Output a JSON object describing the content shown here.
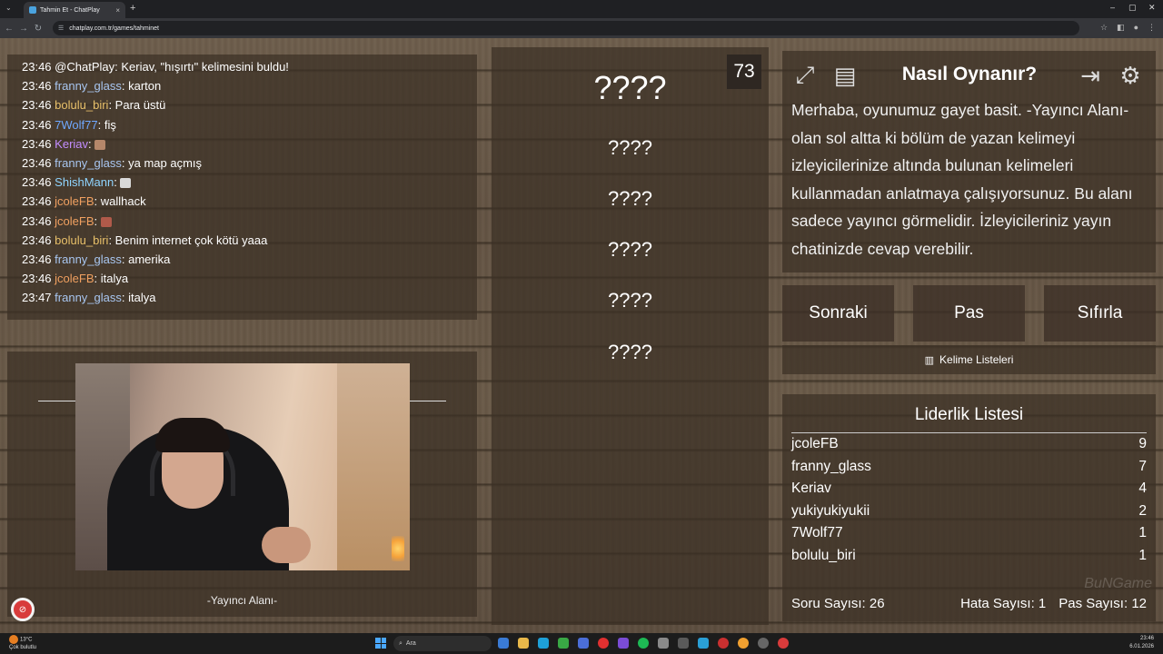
{
  "browser": {
    "tab_title": "Tahmin Et - ChatPlay",
    "tab_close": "×",
    "new_tab": "+",
    "url": "chatplay.com.tr/games/tahminet",
    "nav": {
      "back": "←",
      "forward": "→",
      "reload": "↻",
      "info": "☰"
    },
    "window_controls": {
      "minimize": "–",
      "maximize": "▢",
      "close": "✕"
    }
  },
  "chat": {
    "messages": [
      {
        "time": "23:46",
        "user": "@ChatPlay",
        "color": "#ffffff",
        "sep": ": ",
        "text": "Keriav, \"hışırtı\" kelimesini buldu!"
      },
      {
        "time": "23:46",
        "user": "franny_glass",
        "color": "#a8c6f0",
        "sep": ": ",
        "text": "karton"
      },
      {
        "time": "23:46",
        "user": "bolulu_biri",
        "color": "#e8c06a",
        "sep": ": ",
        "text": "Para üstü"
      },
      {
        "time": "23:46",
        "user": "7Wolf77",
        "color": "#6fa8ff",
        "sep": ": ",
        "text": "fiş"
      },
      {
        "time": "23:46",
        "user": "Keriav",
        "color": "#c28cff",
        "sep": ": ",
        "text": "",
        "emote": "#b5876a"
      },
      {
        "time": "23:46",
        "user": "franny_glass",
        "color": "#a8c6f0",
        "sep": ": ",
        "text": "ya map açmış"
      },
      {
        "time": "23:46",
        "user": "ShishMann",
        "color": "#8fd4ff",
        "sep": ": ",
        "text": "",
        "emote": "#d9d9d9"
      },
      {
        "time": "23:46",
        "user": "jcoleFB",
        "color": "#f0a060",
        "sep": ": ",
        "text": "wallhack"
      },
      {
        "time": "23:46",
        "user": "jcoleFB",
        "color": "#f0a060",
        "sep": ": ",
        "text": "",
        "emote": "#b05a4a"
      },
      {
        "time": "23:46",
        "user": "bolulu_biri",
        "color": "#e8c06a",
        "sep": ": ",
        "text": "Benim internet çok kötü yaaa"
      },
      {
        "time": "23:46",
        "user": "franny_glass",
        "color": "#a8c6f0",
        "sep": ": ",
        "text": "amerika"
      },
      {
        "time": "23:46",
        "user": "jcoleFB",
        "color": "#f0a060",
        "sep": ": ",
        "text": "italya"
      },
      {
        "time": "23:47",
        "user": "franny_glass",
        "color": "#a8c6f0",
        "sep": ": ",
        "text": "italya"
      }
    ]
  },
  "streamer": {
    "label": "-Yayıncı Alanı-"
  },
  "game": {
    "timer": "73",
    "words": [
      "????",
      "????",
      "????",
      "????",
      "????",
      "????"
    ]
  },
  "help": {
    "title": "Nasıl Oynanır?",
    "text": "Merhaba, oyunumuz gayet basit. -Yayıncı Alanı- olan sol altta ki bölüm de yazan kelimeyi izleyicilerinize altında bulunan kelimeleri kullanmadan anlatmaya çalışıyorsunuz. Bu alanı sadece yayıncı görmelidir. İzleyicileriniz yayın chatinizde cevap verebilir.",
    "icons": {
      "fullscreen": "⤢",
      "list": "▤",
      "exit": "⇥",
      "settings": "⚙"
    }
  },
  "controls": {
    "next": "Sonraki",
    "pass": "Pas",
    "reset": "Sıfırla",
    "word_lists": "Kelime Listeleri",
    "word_lists_icon": "▥"
  },
  "leaderboard": {
    "title": "Liderlik Listesi",
    "rows": [
      {
        "name": "jcoleFB",
        "score": "9"
      },
      {
        "name": "franny_glass",
        "score": "7"
      },
      {
        "name": "Keriav",
        "score": "4"
      },
      {
        "name": "yukiyukiyukii",
        "score": "2"
      },
      {
        "name": "7Wolf77",
        "score": "1"
      },
      {
        "name": "bolulu_biri",
        "score": "1"
      }
    ],
    "stats": {
      "questions": "Soru Sayısı: 26",
      "errors": "Hata Sayısı: 1",
      "passes": "Pas Sayısı: 12"
    },
    "watermark": "BuNGame"
  },
  "taskbar": {
    "weather_temp": "13°C",
    "weather_desc": "Çok bulutlu",
    "search_placeholder": "Ara",
    "time": "23:46",
    "date": "6.01.2026"
  },
  "colors": {
    "panel": "#3c3026",
    "wood": "#6a5a48",
    "accent_red": "#d83b3b"
  }
}
